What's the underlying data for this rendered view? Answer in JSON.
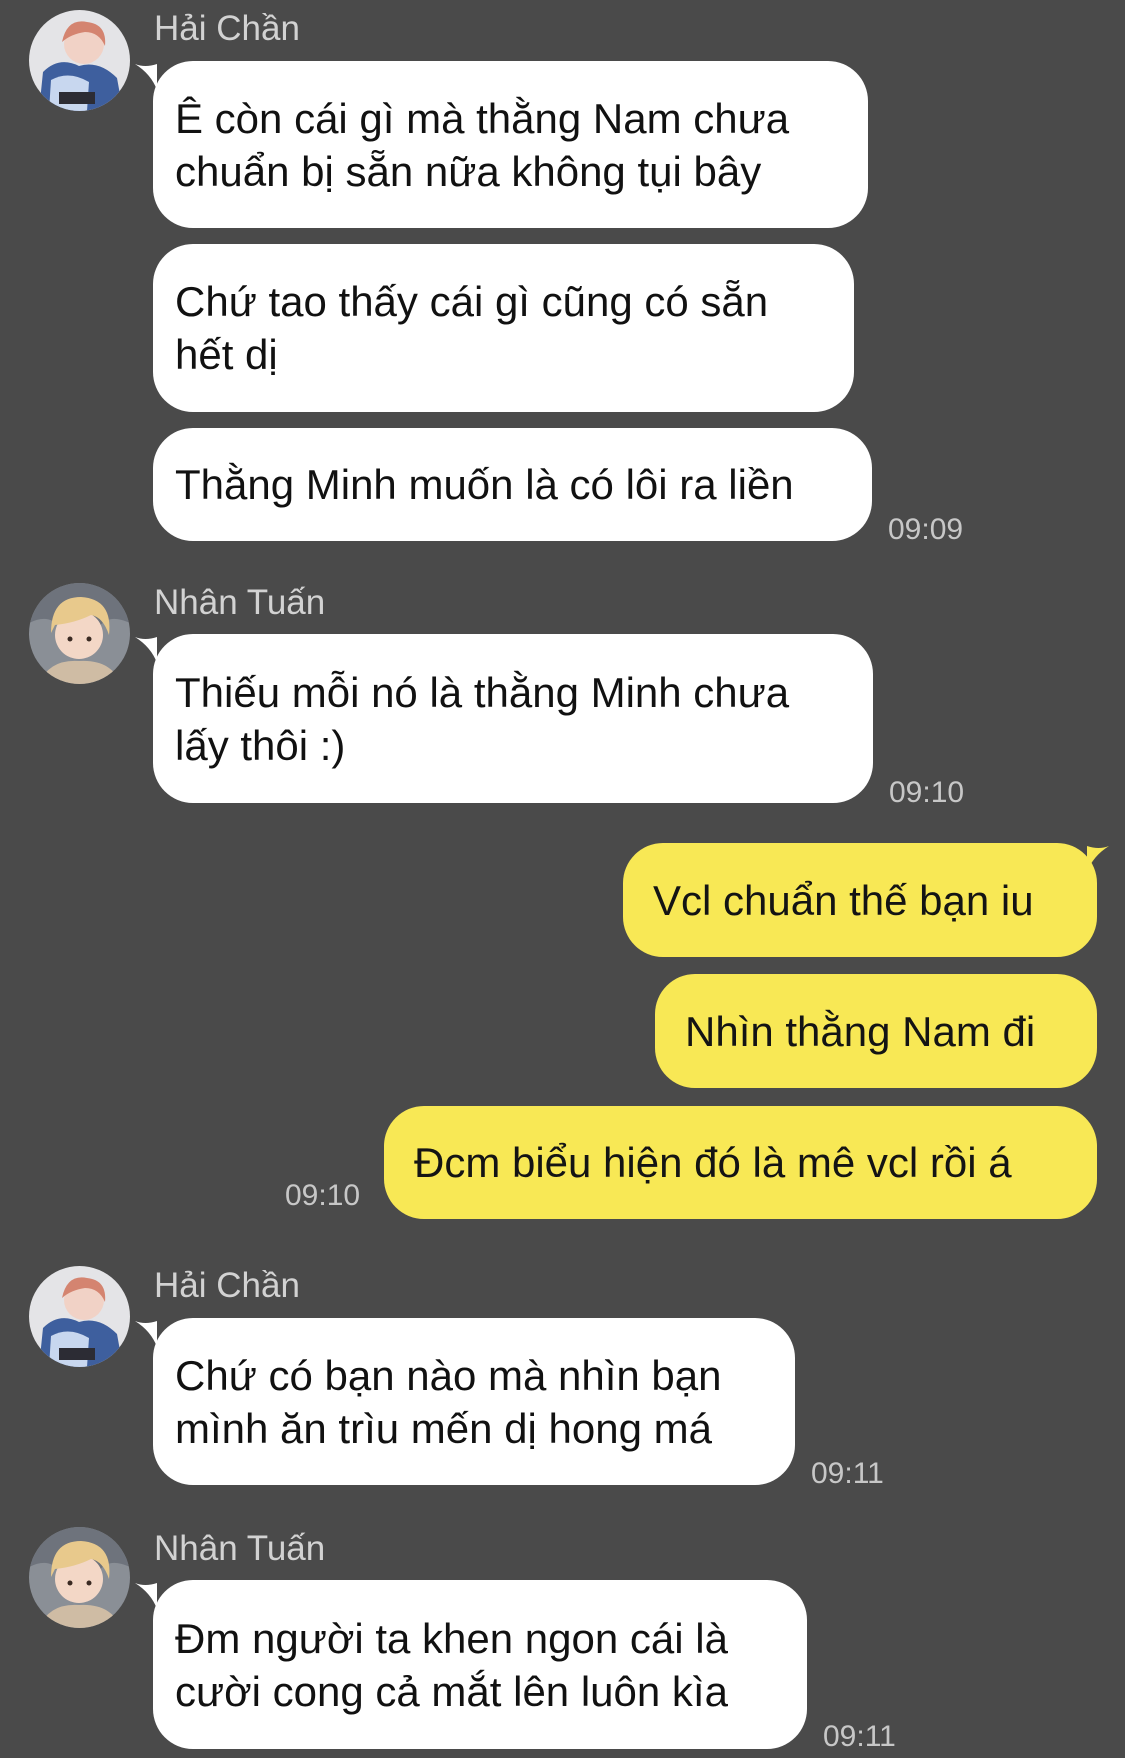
{
  "conversation": [
    {
      "id": "g1",
      "sender": "Hải Chần",
      "avatar": "sender-avatar-hai",
      "messages": [
        {
          "text": "Ê còn cái gì mà thằng Nam chưa\nchuẩn bị sẵn nữa không tụi bây"
        },
        {
          "text": "Chứ tao thấy cái gì cũng có sẵn\nhết dị"
        },
        {
          "text": "Thằng Minh muốn là có lôi ra liền",
          "time": "09:09"
        }
      ]
    },
    {
      "id": "g2",
      "sender": "Nhân Tuấn",
      "avatar": "sender-avatar-nhan",
      "messages": [
        {
          "text": "Thiếu mỗi nó là thằng Minh chưa\nlấy thôi :)",
          "time": "09:10"
        }
      ]
    },
    {
      "id": "g3",
      "sender": "",
      "outgoing": true,
      "messages": [
        {
          "text": "Vcl chuẩn thế bạn iu"
        },
        {
          "text": "Nhìn thằng Nam đi"
        },
        {
          "text": "Đcm biểu hiện đó là mê vcl rồi á",
          "time": "09:10"
        }
      ]
    },
    {
      "id": "g4",
      "sender": "Hải Chần",
      "avatar": "sender-avatar-hai",
      "messages": [
        {
          "text": "Chứ có bạn nào mà nhìn bạn\nmình ăn trìu mến dị hong má",
          "time": "09:11"
        }
      ]
    },
    {
      "id": "g5",
      "sender": "Nhân Tuấn",
      "avatar": "sender-avatar-nhan",
      "messages": [
        {
          "text": "Đm người ta khen ngon cái là\ncười cong cả mắt lên luôn kìa",
          "time": "09:11"
        }
      ]
    }
  ],
  "colors": {
    "background": "#4a4a4a",
    "incoming_bubble": "#ffffff",
    "outgoing_bubble": "#f8e855",
    "sender_name": "#d2d2d2",
    "timestamp": "#c7c7c7"
  }
}
